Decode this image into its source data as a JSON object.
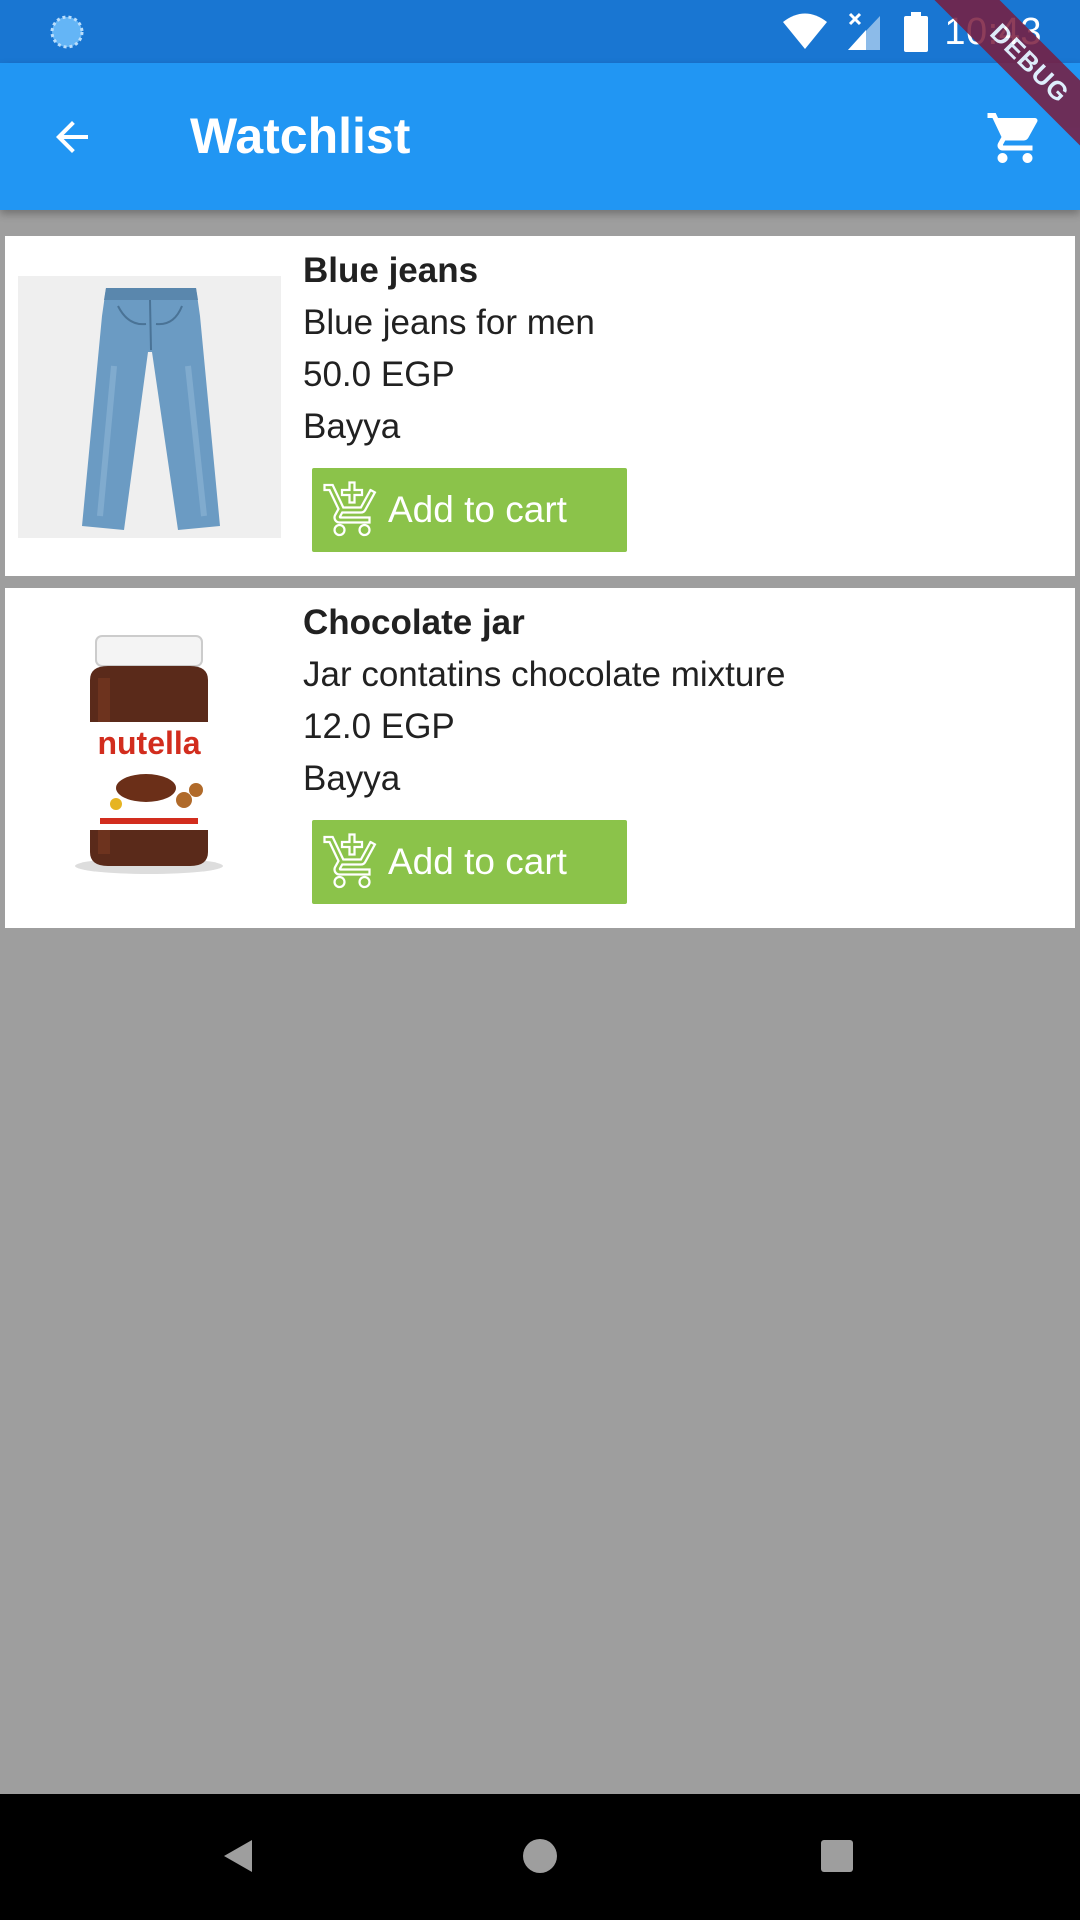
{
  "status_bar": {
    "time": "10:43",
    "icons": [
      "loading-indicator-icon",
      "wifi-icon",
      "signal-icon",
      "battery-icon"
    ]
  },
  "app_bar": {
    "title": "Watchlist",
    "back_icon": "arrow-back-icon",
    "cart_icon": "shopping-cart-icon"
  },
  "debug_banner": "DEBUG",
  "products": [
    {
      "name": "Blue jeans",
      "description": "Blue jeans for men",
      "price": "50.0 EGP",
      "seller": "Bayya",
      "image": "blue-jeans-image",
      "button_label": "Add to cart"
    },
    {
      "name": "Chocolate jar",
      "description": "Jar contatins chocolate mixture",
      "price": "12.0 EGP",
      "seller": "Bayya",
      "image": "nutella-jar-image",
      "image_brand_text": "nutella",
      "button_label": "Add to cart"
    }
  ],
  "colors": {
    "status_bar": "#1976d2",
    "app_bar": "#2196f3",
    "add_button": "#8bc34a",
    "background": "#9e9e9e"
  },
  "nav_bar": {
    "icons": [
      "nav-back-icon",
      "nav-home-icon",
      "nav-recents-icon"
    ]
  }
}
